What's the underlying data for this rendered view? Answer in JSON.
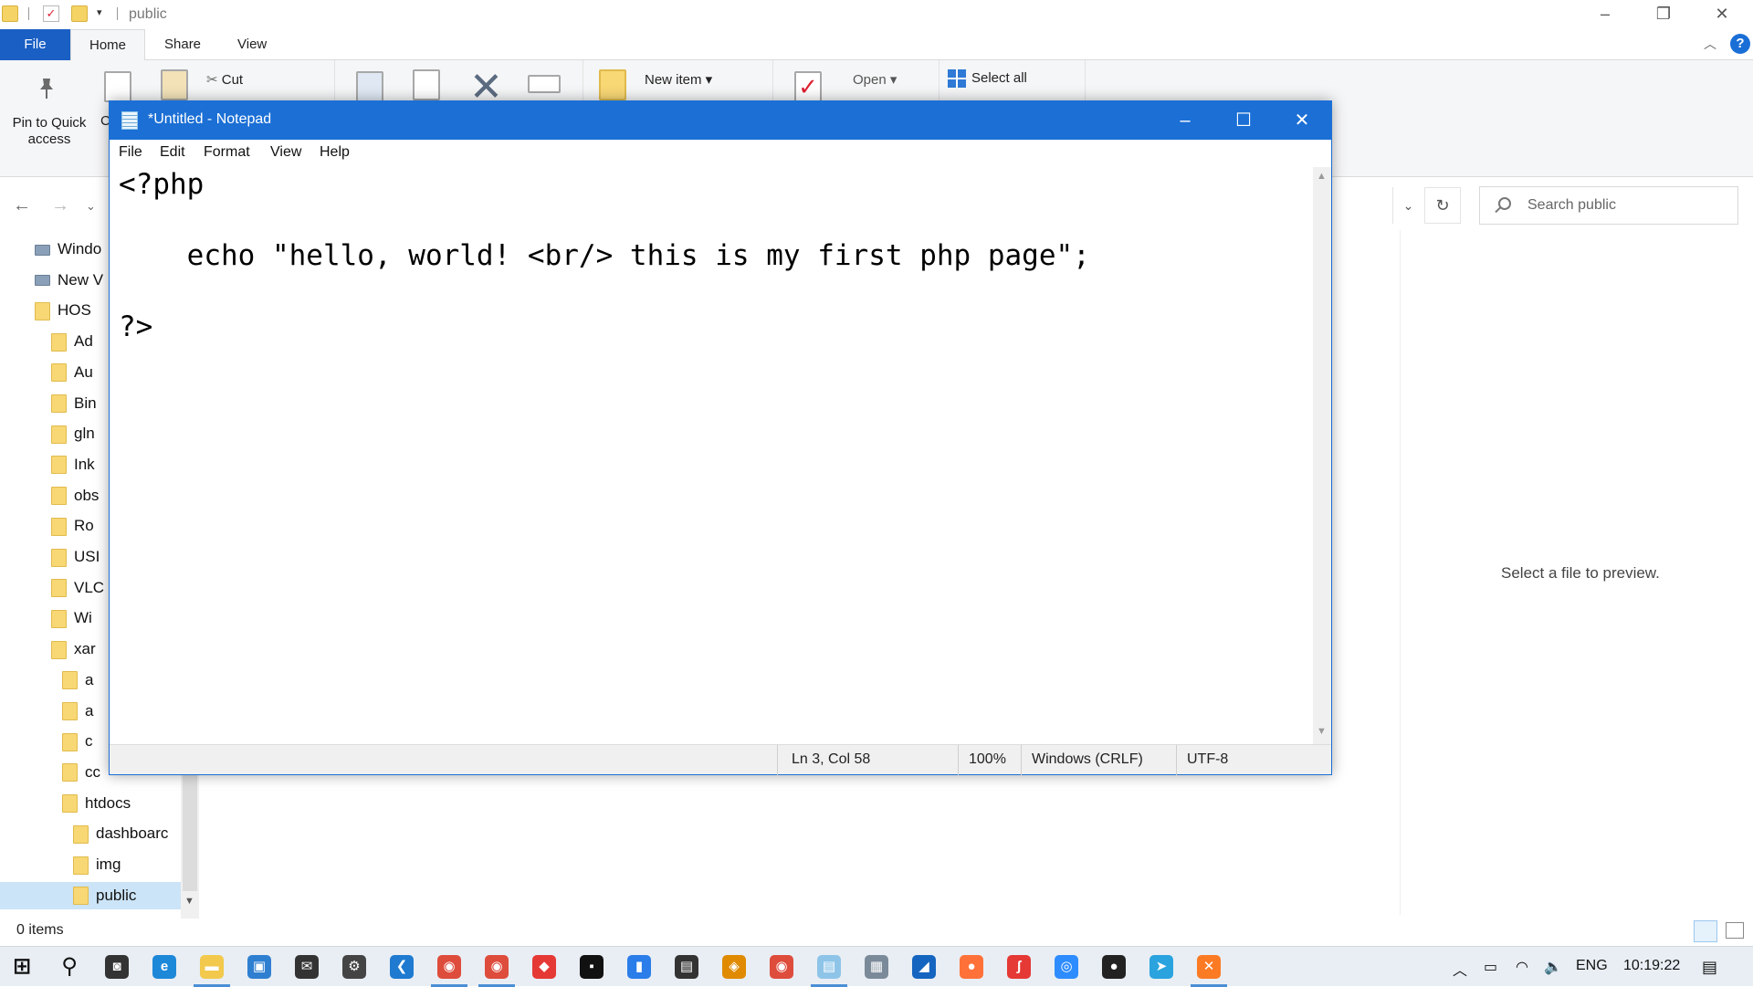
{
  "explorer": {
    "title": "public",
    "tabs": [
      "File",
      "Home",
      "Share",
      "View"
    ],
    "ribbon": {
      "pin_label": "Pin to Quick access",
      "copy_trunc": "C",
      "cut": "Cut",
      "new_item": "New item",
      "open": "Open",
      "select_all": "Select all"
    },
    "search_placeholder": "Search public",
    "tree": [
      {
        "label": "Windo",
        "level": 0
      },
      {
        "label": "New V",
        "level": 0
      },
      {
        "label": "HOS",
        "level": 1
      },
      {
        "label": "Ad",
        "level": 2
      },
      {
        "label": "Au",
        "level": 2
      },
      {
        "label": "Bin",
        "level": 2
      },
      {
        "label": "gln",
        "level": 2
      },
      {
        "label": "Ink",
        "level": 2
      },
      {
        "label": "obs",
        "level": 2
      },
      {
        "label": "Ro",
        "level": 2
      },
      {
        "label": "USI",
        "level": 2
      },
      {
        "label": "VLC",
        "level": 2
      },
      {
        "label": "Wi",
        "level": 2
      },
      {
        "label": "xar",
        "level": 2
      },
      {
        "label": "a",
        "level": 3
      },
      {
        "label": "a",
        "level": 3
      },
      {
        "label": "c",
        "level": 3
      },
      {
        "label": "cc",
        "level": 3
      },
      {
        "label": "htdocs",
        "level": 3
      },
      {
        "label": "dashboarc",
        "level": 4
      },
      {
        "label": "img",
        "level": 4
      },
      {
        "label": "public",
        "level": 4
      }
    ],
    "preview_text": "Select a file to preview.",
    "status": "0 items"
  },
  "notepad": {
    "title": "*Untitled - Notepad",
    "menu": [
      "File",
      "Edit",
      "Format",
      "View",
      "Help"
    ],
    "content": "<?php\n\n    echo \"hello, world! <br/> this is my first php page\";\n\n?>",
    "status": {
      "position": "Ln 3, Col 58",
      "zoom": "100%",
      "line_ending": "Windows (CRLF)",
      "encoding": "UTF-8"
    }
  },
  "taskbar": {
    "icons": [
      "windows-start",
      "search",
      "camera",
      "edge",
      "file-explorer",
      "app-store",
      "mail",
      "settings",
      "vscode",
      "chrome",
      "chrome-2",
      "anydesk",
      "terminal",
      "phone",
      "store",
      "game",
      "chrome-3",
      "notepad",
      "chart",
      "shark",
      "firefox",
      "git",
      "zoom",
      "obs",
      "telegram",
      "xampp"
    ],
    "language": "ENG",
    "time": "10:19:22"
  }
}
